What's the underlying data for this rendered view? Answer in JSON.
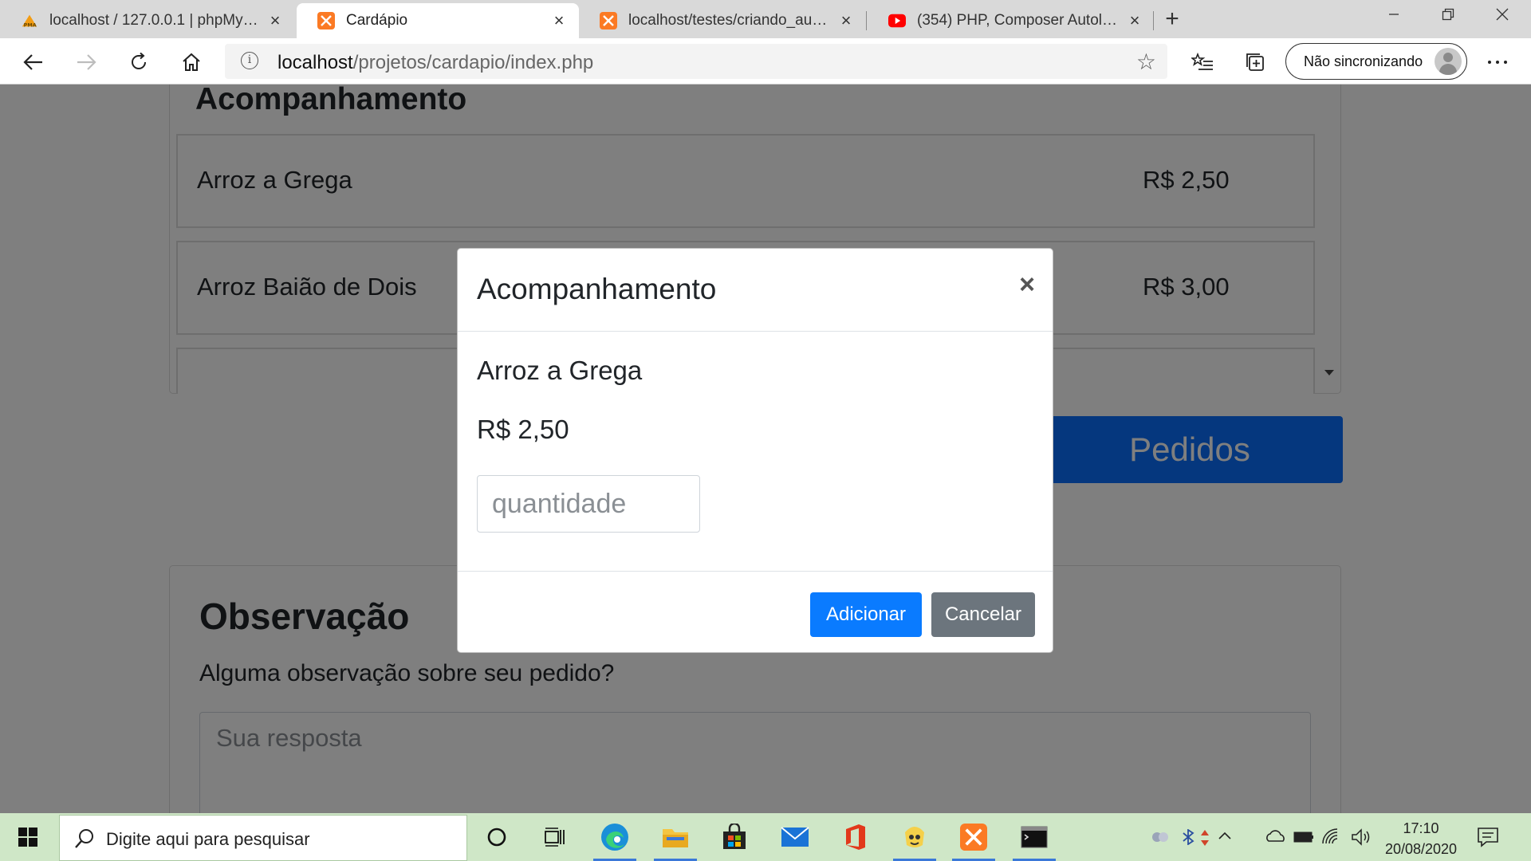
{
  "browser": {
    "tabs": [
      {
        "title": "localhost / 127.0.0.1 | phpMyAdmin",
        "icon": "phpmyadmin-icon"
      },
      {
        "title": "Cardápio",
        "icon": "xampp-icon"
      },
      {
        "title": "localhost/testes/criando_autoload",
        "icon": "xampp-icon"
      },
      {
        "title": "(354) PHP, Composer Autoload e",
        "icon": "youtube-icon"
      }
    ],
    "active_tab": 1,
    "address": {
      "host": "localhost",
      "path": "/projetos/cardapio/index.php"
    },
    "profile_label": "Não sincronizando"
  },
  "page": {
    "section_title": "Acompanhamento",
    "items": [
      {
        "name": "Arroz a Grega",
        "price": "R$ 2,50"
      },
      {
        "name": "Arroz Baião de Dois",
        "price": "R$ 3,00"
      }
    ],
    "orders_button": "Pedidos",
    "observation": {
      "title": "Observação",
      "question": "Alguma observação sobre seu pedido?",
      "placeholder": "Sua resposta"
    }
  },
  "modal": {
    "title": "Acompanhamento",
    "close": "×",
    "item_name": "Arroz a Grega",
    "item_price": "R$ 2,50",
    "quantity_placeholder": "quantidade",
    "add_label": "Adicionar",
    "cancel_label": "Cancelar"
  },
  "taskbar": {
    "search_placeholder": "Digite aqui para pesquisar",
    "time": "17:10",
    "date": "20/08/2020"
  },
  "colors": {
    "primary": "#0a7bff",
    "secondary": "#6c757d",
    "taskbar": "#cfe7c7"
  }
}
